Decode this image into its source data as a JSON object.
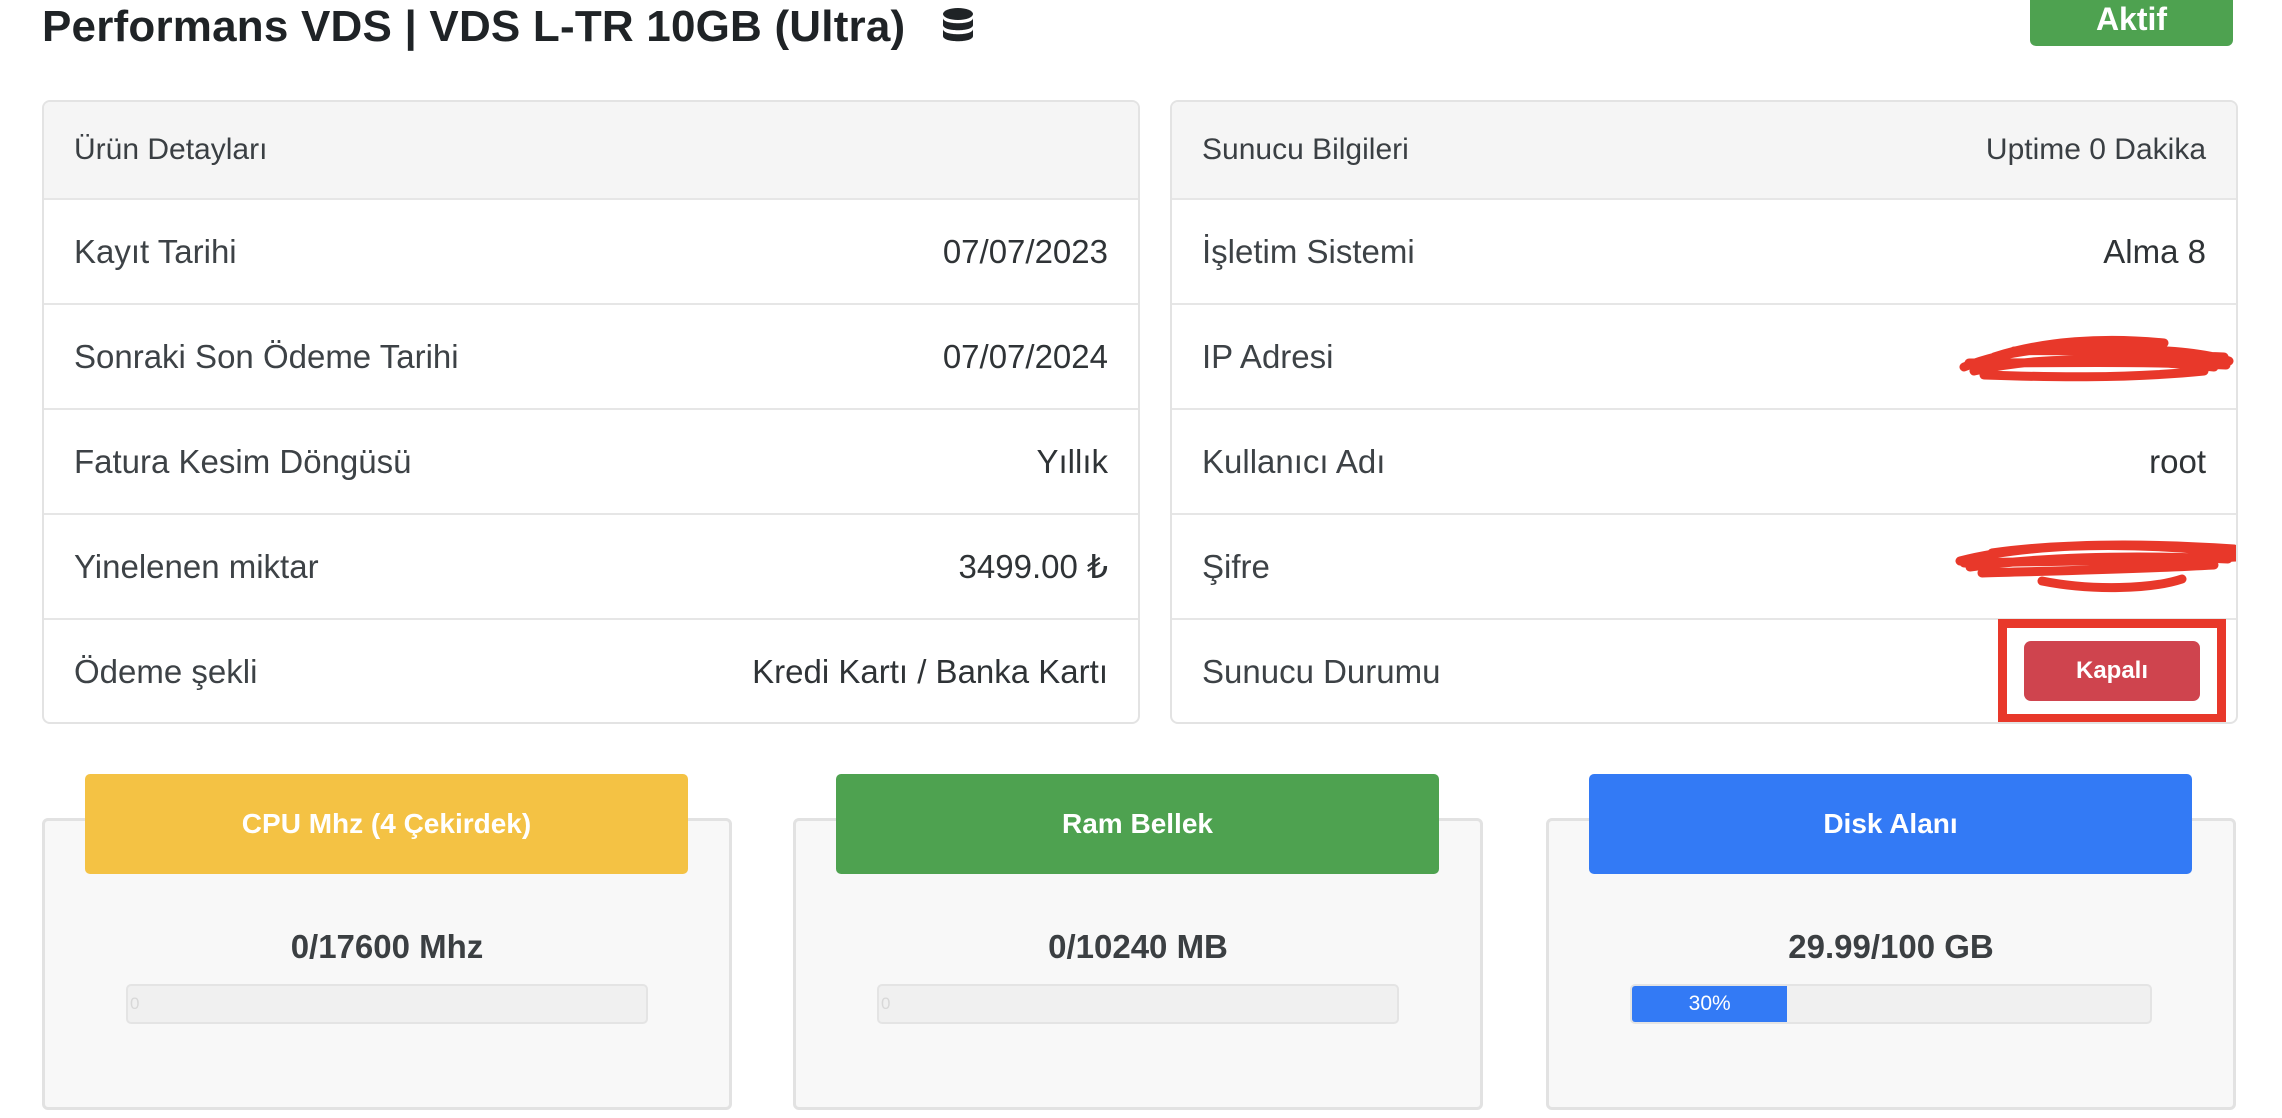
{
  "page": {
    "title": "Performans VDS | VDS L-TR 10GB (Ultra)",
    "title_icon": "database-icon",
    "status": "Aktif"
  },
  "product": {
    "header": "Ürün Detayları",
    "rows": [
      {
        "label": "Kayıt Tarihi",
        "value": "07/07/2023"
      },
      {
        "label": "Sonraki Son Ödeme Tarihi",
        "value": "07/07/2024"
      },
      {
        "label": "Fatura Kesim Döngüsü",
        "value": "Yıllık"
      },
      {
        "label": "Yinelenen miktar",
        "value": "3499.00 ₺"
      },
      {
        "label": "Ödeme şekli",
        "value": "Kredi Kartı / Banka Kartı"
      }
    ]
  },
  "server": {
    "header": "Sunucu Bilgileri",
    "uptime": "Uptime 0 Dakika",
    "os_label": "İşletim Sistemi",
    "os_value": "Alma 8",
    "ip_label": "IP Adresi",
    "user_label": "Kullanıcı Adı",
    "user_value": "root",
    "password_label": "Şifre",
    "status_label": "Sunucu Durumu",
    "status_button": "Kapalı"
  },
  "resources": [
    {
      "title": "CPU Mhz (4 Çekirdek)",
      "value": "0/17600 Mhz",
      "percent": 0,
      "bar_label": "0",
      "color": "#f4c244"
    },
    {
      "title": "Ram Bellek",
      "value": "0/10240 MB",
      "percent": 0,
      "bar_label": "0",
      "color": "#4ea250"
    },
    {
      "title": "Disk Alanı",
      "value": "29.99/100 GB",
      "percent": 30,
      "bar_label": "30%",
      "color": "#337af5"
    }
  ],
  "colors": {
    "status_active": "#4ea250",
    "status_off": "#cf444e",
    "highlight_frame": "#e8382a",
    "redaction": "#e8382a"
  }
}
